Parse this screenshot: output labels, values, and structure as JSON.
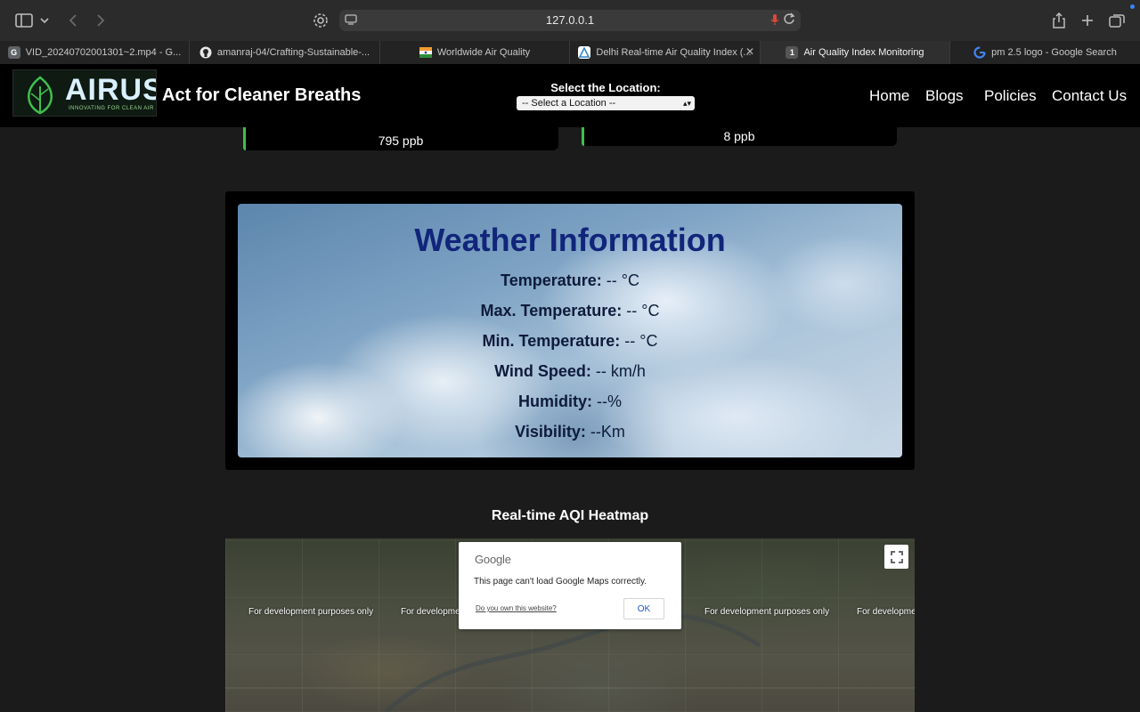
{
  "browser": {
    "address": "127.0.0.1",
    "tabs": [
      {
        "label": "VID_20240702001301~2.mp4 - G...",
        "favicon": "G"
      },
      {
        "label": "amanraj-04/Crafting-Sustainable-...",
        "favicon": "github-icon"
      },
      {
        "label": "Worldwide Air Quality",
        "favicon": "flag-icon"
      },
      {
        "label": "Delhi Real-time Air Quality Index (...",
        "favicon": "aqi-icon"
      },
      {
        "label": "Air Quality Index Monitoring",
        "favicon": "1"
      },
      {
        "label": "pm 2.5 logo - Google Search",
        "favicon": "google-icon"
      }
    ],
    "active_tab_index": 4
  },
  "site": {
    "logo_text": "AIRUS",
    "logo_tagline": "INNOVATING FOR CLEAN AIR",
    "title": "Act for Cleaner Breaths",
    "location_label": "Select the Location:",
    "location_selected": "-- Select a Location --",
    "nav": [
      "Home",
      "Blogs",
      "Policies",
      "Contact Us"
    ]
  },
  "readings": {
    "left_value": "795 ppb",
    "right_value": "8 ppb"
  },
  "weather": {
    "title": "Weather Information",
    "rows": [
      {
        "label": "Temperature:",
        "value": "-- °C"
      },
      {
        "label": "Max. Temperature:",
        "value": "-- °C"
      },
      {
        "label": "Min. Temperature:",
        "value": "-- °C"
      },
      {
        "label": "Wind Speed:",
        "value": "-- km/h"
      },
      {
        "label": "Humidity:",
        "value": "--%"
      },
      {
        "label": "Visibility:",
        "value": "--Km"
      }
    ]
  },
  "heatmap": {
    "title": "Real-time AQI Heatmap",
    "dev_text": "For development purposes only",
    "dialog": {
      "brand": "Google",
      "message": "This page can't load Google Maps correctly.",
      "link": "Do you own this website?",
      "ok": "OK"
    }
  },
  "colors": {
    "accent_green": "#3fbf4e",
    "weather_title": "#11257a",
    "header_bg": "#000000",
    "page_bg": "#1b1b1b"
  }
}
